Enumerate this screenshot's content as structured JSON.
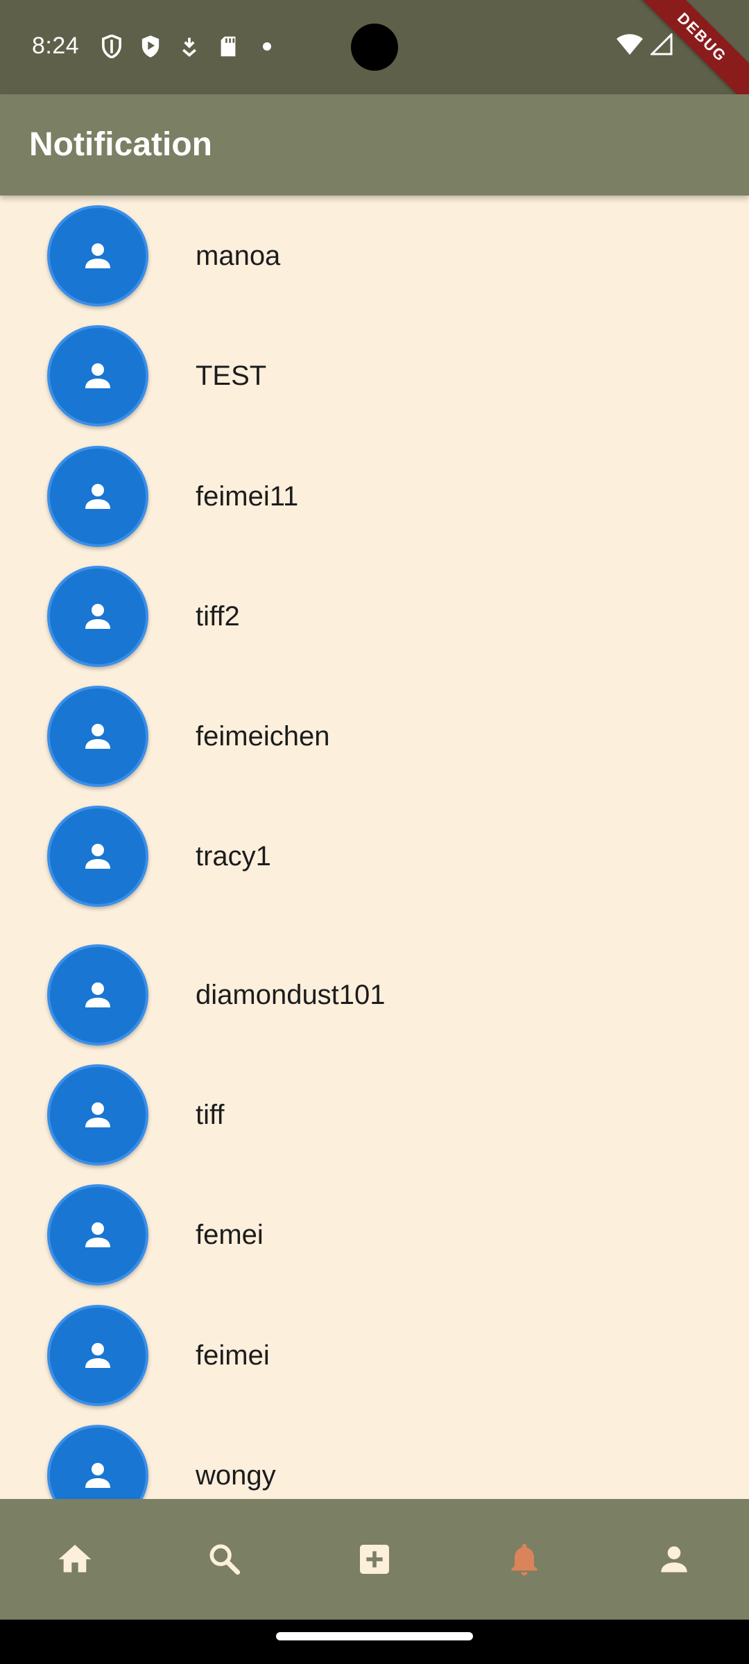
{
  "status_bar": {
    "time": "8:24",
    "icons_left": [
      "shield-outline-icon",
      "shield-play-icon",
      "download-arrow-icon",
      "sd-card-icon",
      "dot-icon"
    ],
    "icons_right": [
      "wifi-icon",
      "cell-signal-icon"
    ],
    "debug_label": "DEBUG"
  },
  "app_bar": {
    "title": "Notification"
  },
  "notifications": [
    {
      "username": "manoa"
    },
    {
      "username": "TEST"
    },
    {
      "username": "feimei11"
    },
    {
      "username": "tiff2"
    },
    {
      "username": "feimeichen"
    },
    {
      "username": "tracy1"
    },
    {
      "username": "diamondust101"
    },
    {
      "username": "tiff"
    },
    {
      "username": "femei"
    },
    {
      "username": "feimei"
    },
    {
      "username": "wongy"
    }
  ],
  "bottom_nav": {
    "items": [
      {
        "icon": "home-icon",
        "active": false
      },
      {
        "icon": "search-icon",
        "active": false
      },
      {
        "icon": "add-box-icon",
        "active": false
      },
      {
        "icon": "bell-icon",
        "active": true
      },
      {
        "icon": "person-icon",
        "active": false
      }
    ]
  },
  "colors": {
    "status_bar": "#5e6049",
    "app_bar": "#7b7f63",
    "background": "#fcefdc",
    "avatar": "#1976d2",
    "nav_icon": "#fcefdc",
    "nav_active": "#d9845a",
    "debug_ribbon": "#8b1c1c"
  }
}
